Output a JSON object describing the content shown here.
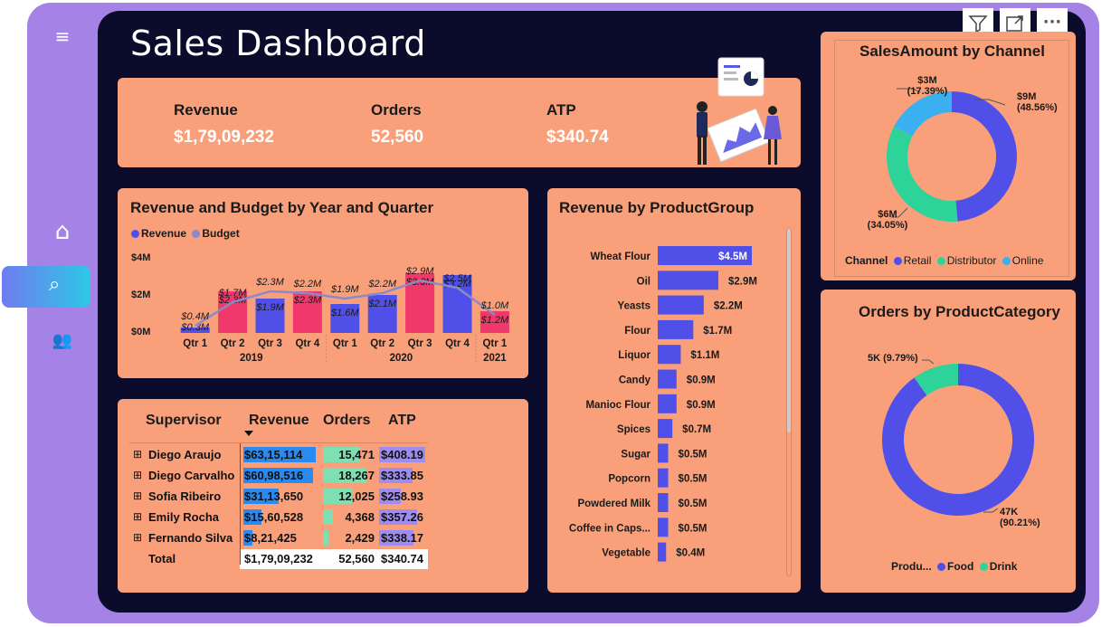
{
  "page_title": "Sales Dashboard",
  "toolbar": {
    "filter_label": "filter",
    "expand_label": "expand",
    "more_label": "···"
  },
  "nav": [
    {
      "name": "filter-icon",
      "glyph": "≡"
    },
    {
      "name": "home-icon",
      "glyph": "⌂"
    },
    {
      "name": "report-icon",
      "glyph": "⌕"
    },
    {
      "name": "people-icon",
      "glyph": "👥"
    }
  ],
  "kpis": [
    {
      "label": "Revenue",
      "value": "$1,79,09,232"
    },
    {
      "label": "Orders",
      "value": "52,560"
    },
    {
      "label": "ATP",
      "value": "$340.74"
    }
  ],
  "revenue_budget": {
    "title": "Revenue and Budget by Year and Quarter",
    "legend": [
      "Revenue",
      "Budget"
    ],
    "y_ticks": [
      "$4M",
      "$2M",
      "$0M"
    ],
    "quarters": [
      "Qtr 1",
      "Qtr 2",
      "Qtr 3",
      "Qtr 4",
      "Qtr 1",
      "Qtr 2",
      "Qtr 3",
      "Qtr 4",
      "Qtr 1"
    ],
    "years": [
      "2019",
      "2020",
      "2021"
    ]
  },
  "product_group": {
    "title": "Revenue by ProductGroup"
  },
  "channel": {
    "title": "SalesAmount by Channel",
    "legend_title": "Channel",
    "labels": [
      {
        "value": "$9M",
        "pct": "(48.56%)"
      },
      {
        "value": "$6M",
        "pct": "(34.05%)"
      },
      {
        "value": "$3M",
        "pct": "(17.39%)"
      }
    ]
  },
  "category": {
    "title": "Orders by ProductCategory",
    "legend_title": "Produ...",
    "labels": [
      {
        "value": "5K (9.79%)"
      },
      {
        "value": "47K",
        "pct": "(90.21%)"
      }
    ]
  },
  "supervisor_table": {
    "headers": [
      "Supervisor",
      "Revenue",
      "Orders",
      "ATP"
    ],
    "rows": [
      {
        "name": "Diego Araujo",
        "revenue": "$63,15,114",
        "orders": "15,471",
        "atp": "$408.19",
        "rev_frac": 1.0,
        "ord_frac": 0.847,
        "atp_frac": 0.98
      },
      {
        "name": "Diego Carvalho",
        "revenue": "$60,98,516",
        "orders": "18,267",
        "atp": "$333.85",
        "rev_frac": 0.966,
        "ord_frac": 1.0,
        "atp_frac": 0.72
      },
      {
        "name": "Sofia Ribeiro",
        "revenue": "$31,13,650",
        "orders": "12,025",
        "atp": "$258.93",
        "rev_frac": 0.493,
        "ord_frac": 0.658,
        "atp_frac": 0.47
      },
      {
        "name": "Emily Rocha",
        "revenue": "$15,60,528",
        "orders": "4,368",
        "atp": "$357.26",
        "rev_frac": 0.247,
        "ord_frac": 0.239,
        "atp_frac": 0.8
      },
      {
        "name": "Fernando Silva",
        "revenue": "$8,21,425",
        "orders": "2,429",
        "atp": "$338.17",
        "rev_frac": 0.13,
        "ord_frac": 0.133,
        "atp_frac": 0.74
      }
    ],
    "total": {
      "name": "Total",
      "revenue": "$1,79,09,232",
      "orders": "52,560",
      "atp": "$340.74"
    }
  },
  "colors": {
    "panel": "#f9a07a",
    "canvas": "#0b0b2c",
    "frame": "#a582e6",
    "revenue": "#5050e8",
    "budget": "#8a8ac8",
    "neg": "#f0386b",
    "distributor": "#2ed39a",
    "online": "#3ab0f0",
    "orders_bar": "#7ee0b0",
    "atp_bar": "#9f8cf0"
  },
  "chart_data": [
    {
      "type": "bar",
      "title": "Revenue and Budget by Year and Quarter",
      "categories": [
        "2019 Qtr 1",
        "2019 Qtr 2",
        "2019 Qtr 3",
        "2019 Qtr 4",
        "2020 Qtr 1",
        "2020 Qtr 2",
        "2020 Qtr 3",
        "2020 Qtr 4",
        "2021 Qtr 1"
      ],
      "series": [
        {
          "name": "Revenue",
          "values": [
            0.3,
            2.3,
            1.9,
            2.3,
            1.6,
            2.1,
            3.3,
            3.2,
            1.2
          ],
          "labels": [
            "$0.3M",
            "$2.3M",
            "$1.9M",
            "$2.3M",
            "$1.6M",
            "$2.1M",
            "$3.3M",
            "$3.2M",
            "$1.2M"
          ]
        },
        {
          "name": "Budget",
          "values": [
            0.4,
            1.7,
            2.3,
            2.2,
            1.9,
            2.2,
            2.9,
            2.5,
            1.0
          ],
          "labels": [
            "$0.4M",
            "$1.7M",
            "$2.3M",
            "$2.2M",
            "$1.9M",
            "$2.2M",
            "$2.9M",
            "$2.5M",
            "$1.0M"
          ]
        }
      ],
      "below_budget": [
        false,
        false,
        true,
        false,
        true,
        true,
        false,
        false,
        false
      ],
      "ylim": [
        0,
        4
      ]
    },
    {
      "type": "bar",
      "title": "Revenue by ProductGroup",
      "orientation": "horizontal",
      "categories": [
        "Wheat Flour",
        "Oil",
        "Yeasts",
        "Flour",
        "Liquor",
        "Candy",
        "Manioc Flour",
        "Spices",
        "Sugar",
        "Popcorn",
        "Powdered Milk",
        "Coffee in Caps...",
        "Vegetable"
      ],
      "values": [
        4.5,
        2.9,
        2.2,
        1.7,
        1.1,
        0.9,
        0.9,
        0.7,
        0.5,
        0.5,
        0.5,
        0.5,
        0.4
      ],
      "labels": [
        "$4.5M",
        "$2.9M",
        "$2.2M",
        "$1.7M",
        "$1.1M",
        "$0.9M",
        "$0.9M",
        "$0.7M",
        "$0.5M",
        "$0.5M",
        "$0.5M",
        "$0.5M",
        "$0.4M"
      ]
    },
    {
      "type": "pie",
      "title": "SalesAmount by Channel",
      "categories": [
        "Retail",
        "Distributor",
        "Online"
      ],
      "values": [
        48.56,
        34.05,
        17.39
      ]
    },
    {
      "type": "pie",
      "title": "Orders by ProductCategory",
      "categories": [
        "Food",
        "Drink"
      ],
      "values": [
        90.21,
        9.79
      ]
    }
  ]
}
